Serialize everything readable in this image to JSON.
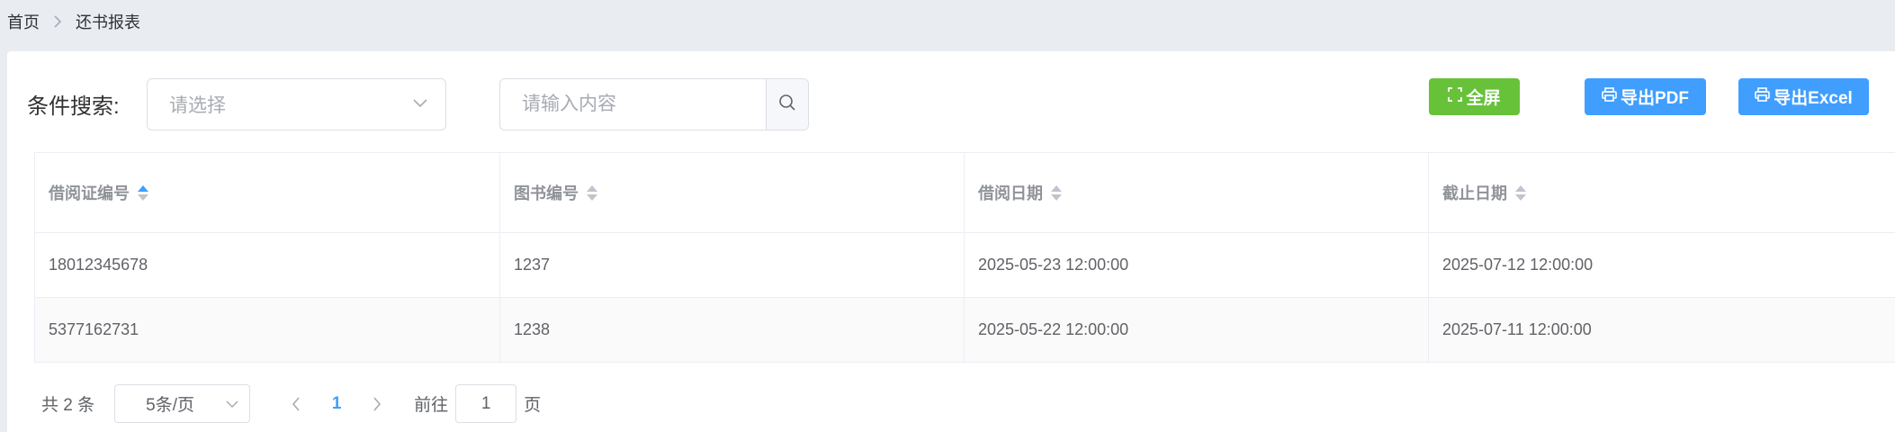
{
  "breadcrumb": {
    "home": "首页",
    "current": "还书报表"
  },
  "search": {
    "label": "条件搜索:",
    "select_placeholder": "请选择",
    "input_placeholder": "请输入内容"
  },
  "toolbar": {
    "fullscreen_label": "全屏",
    "export_pdf_label": "导出PDF",
    "export_excel_label": "导出Excel"
  },
  "table": {
    "columns": [
      "借阅证编号",
      "图书编号",
      "借阅日期",
      "截止日期"
    ],
    "rows": [
      [
        "18012345678",
        "1237",
        "2025-05-23 12:00:00",
        "2025-07-12 12:00:00"
      ],
      [
        "5377162731",
        "1238",
        "2025-05-22 12:00:00",
        "2025-07-11 12:00:00"
      ]
    ]
  },
  "pagination": {
    "total_text": "共 2 条",
    "page_size": "5条/页",
    "current_page": "1",
    "goto_label": "前往",
    "goto_value": "1",
    "page_suffix": "页"
  },
  "colors": {
    "primary": "#409eff",
    "success": "#67c23a",
    "background": "#e9ecf1"
  }
}
